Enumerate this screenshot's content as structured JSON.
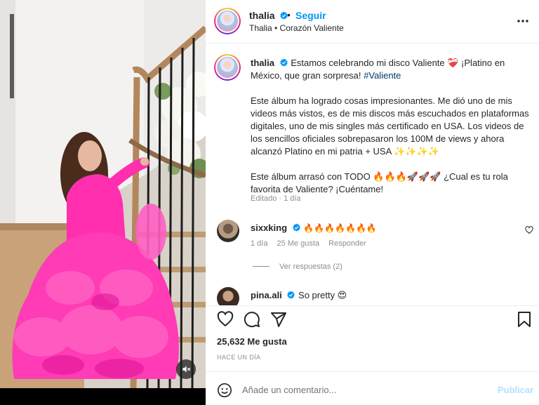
{
  "post": {
    "username": "thalia",
    "follow_label": "Seguir",
    "separator": "•",
    "subtitle": "Thalia • Corazón Valiente"
  },
  "caption": {
    "username": "thalia",
    "line1": "Estamos celebrando mi disco Valiente ❤️‍🩹 ¡Platino en México, que gran sorpresa! ",
    "hashtag": "#Valiente",
    "para2": "Este álbum ha logrado cosas impresionantes. Me dió uno de mis videos más vistos, es de mis discos más escuchados en plataformas digitales, uno de mis singles más certificado en USA. Los videos de los sencillos oficiales sobrepasaron los 100M de views y ahora alcanzó Platino en mi patria + USA ✨✨✨✨",
    "para3": "Este álbum arrasó con TODO 🔥🔥🔥🚀🚀🚀 ¿Cual es tu rola favorita de Valiente? ¡Cuéntame!",
    "meta": "Editado · 1 día"
  },
  "comments": [
    {
      "username": "sixxking",
      "text": "🔥🔥🔥🔥🔥🔥🔥",
      "time": "1 día",
      "likes": "25 Me gusta",
      "reply_label": "Responder",
      "view_replies": "Ver respuestas (2)"
    },
    {
      "username": "pina.ali",
      "text": "So pretty 😍"
    }
  ],
  "actions": {
    "likes_count": "25,632 Me gusta",
    "time_ago": "HACE UN DÍA"
  },
  "composer": {
    "placeholder": "Añade un comentario...",
    "post_label": "Publicar"
  },
  "colors": {
    "accent": "#0095f6",
    "dress": "#ff2fb0",
    "post_disabled": "#b2dffc"
  },
  "icons": [
    "verified-badge-icon",
    "more-options-icon",
    "heart-icon",
    "comment-icon",
    "share-icon",
    "save-icon",
    "emoji-icon",
    "mute-icon"
  ]
}
